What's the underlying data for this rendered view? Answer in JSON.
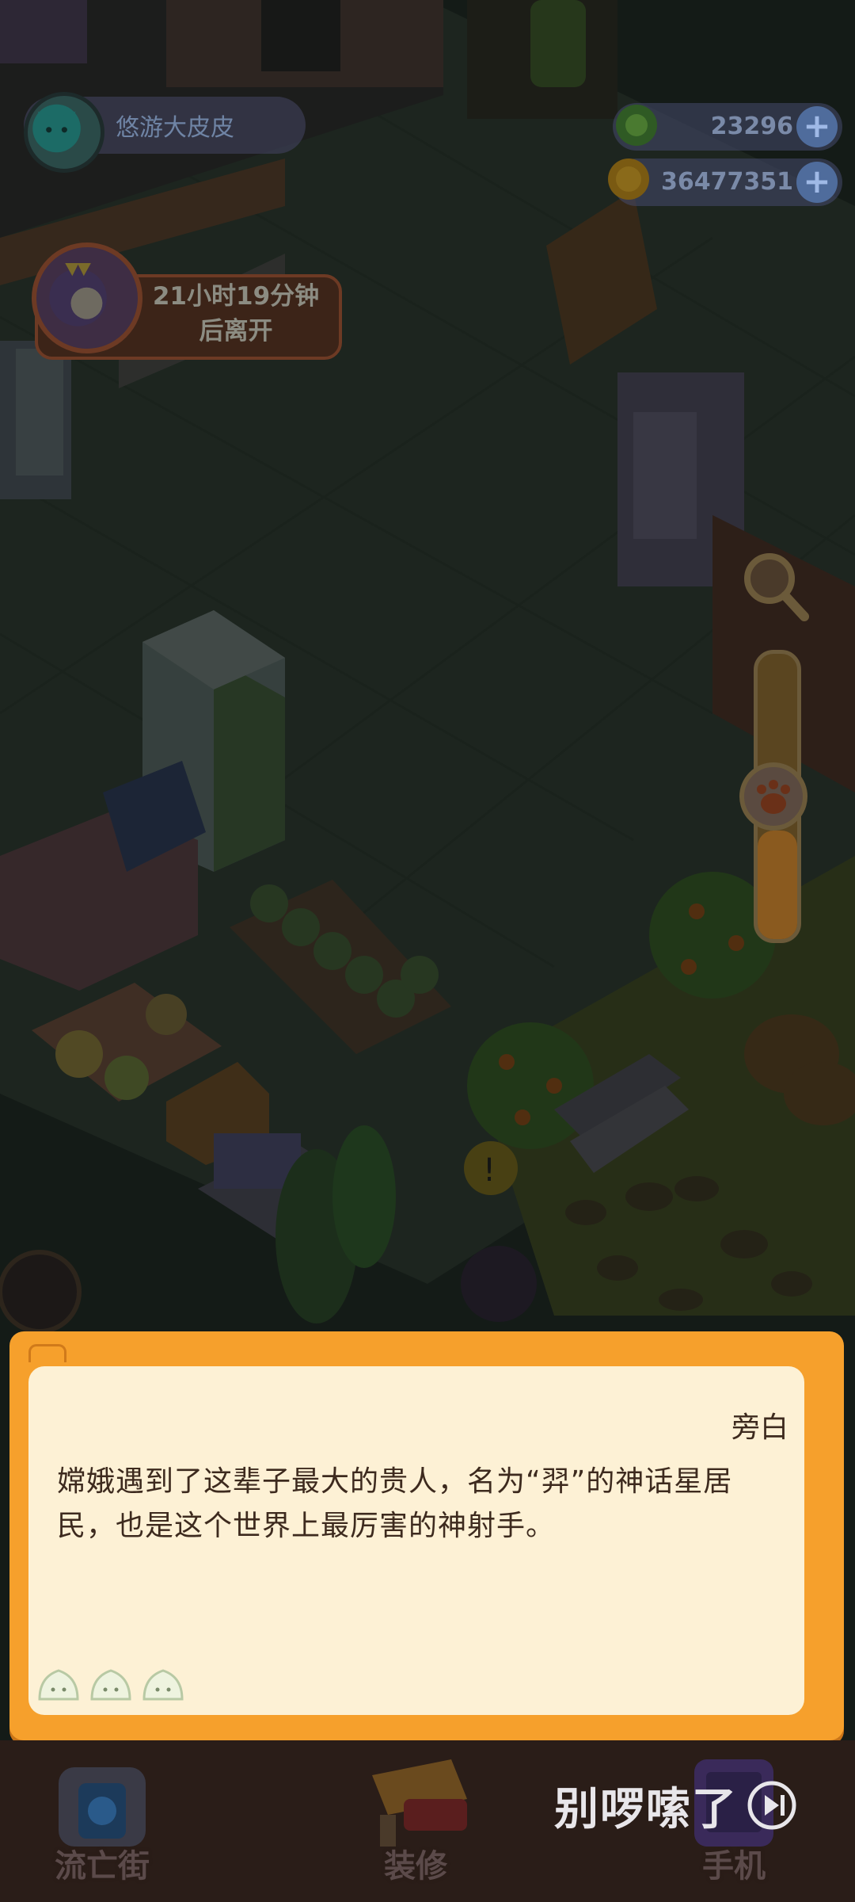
{
  "hud": {
    "player_name": "悠游大皮皮",
    "currency_1": "23296",
    "currency_2": "36477351",
    "plus_symbol": "+"
  },
  "visitor": {
    "timer_line1": "21小时19分钟",
    "timer_line2": "后离开"
  },
  "dialog": {
    "speaker": "旁白",
    "text": "嫦娥遇到了这辈子最大的贵人，名为“羿”的神话星居民，也是这个世界上最厉害的神射手。",
    "bun_count": 3
  },
  "bottom_nav": {
    "items": [
      {
        "label": "流亡街",
        "icon": "door-portal-icon"
      },
      {
        "label": "装修",
        "icon": "paint-roller-icon"
      },
      {
        "label": "手机",
        "icon": "phone-icon"
      }
    ]
  },
  "skip_button": {
    "label": "别啰嗦了",
    "icon": "play-circle-icon"
  },
  "zoom_slider": {
    "level": 0.38
  },
  "colors": {
    "dialog_border": "#f6a02c",
    "dialog_fill": "#fdf1d5",
    "dialog_text": "#3d2a1e",
    "scene_floor": "#2c3a30"
  }
}
